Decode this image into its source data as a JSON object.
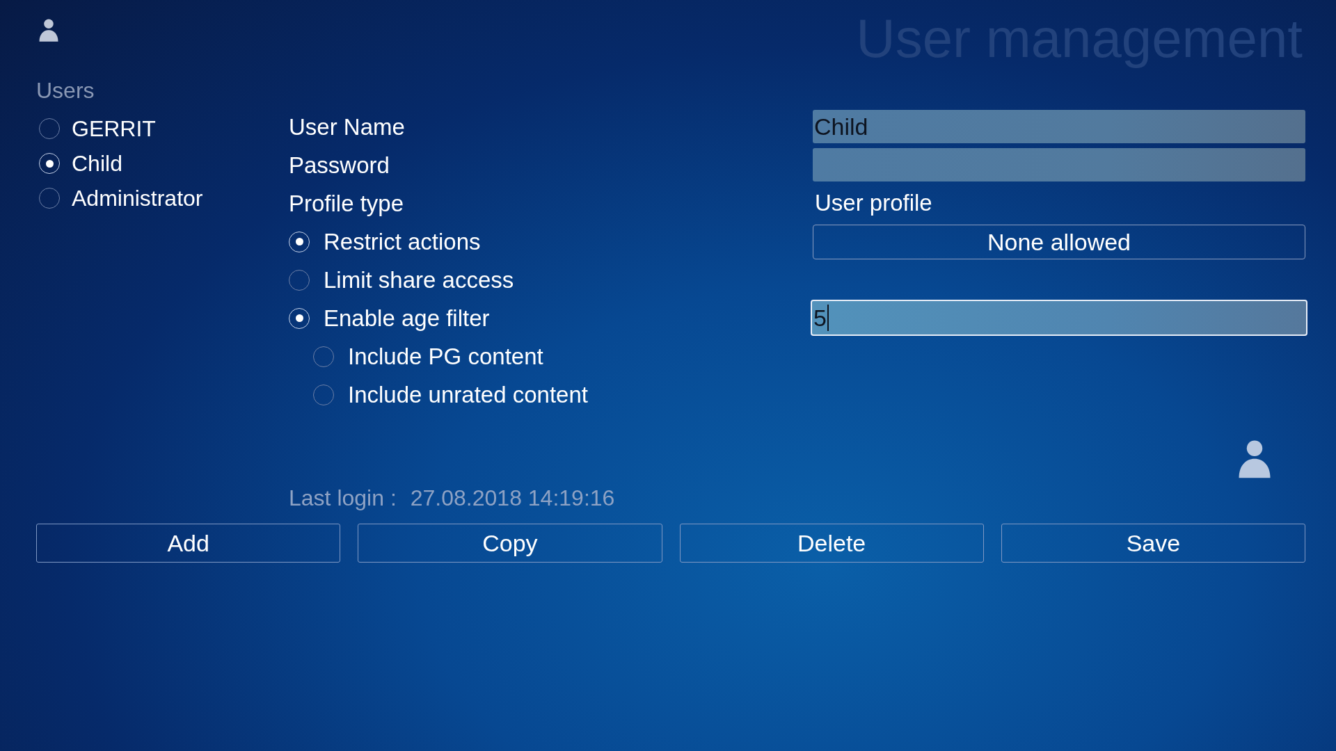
{
  "header": {
    "title": "User management"
  },
  "users": {
    "heading": "Users",
    "items": [
      {
        "name": "GERRIT",
        "selected": false
      },
      {
        "name": "Child",
        "selected": true
      },
      {
        "name": "Administrator",
        "selected": false
      }
    ]
  },
  "user_name": {
    "label": "User Name",
    "value": "Child"
  },
  "password": {
    "label": "Password"
  },
  "profile_type": {
    "label": "Profile type",
    "options": [
      {
        "label": "Restrict actions",
        "checked": true
      },
      {
        "label": "Limit share access",
        "checked": false
      },
      {
        "label": "Enable age filter",
        "checked": true,
        "children": [
          {
            "label": "Include PG content",
            "checked": false
          },
          {
            "label": "Include unrated content",
            "checked": false
          }
        ]
      }
    ]
  },
  "user_profile": {
    "label": "User profile",
    "value": "None allowed"
  },
  "age_filter": {
    "value": "5",
    "focused": true
  },
  "last_login": {
    "label": "Last login :",
    "value": "27.08.2018 14:19:16"
  },
  "buttons": [
    "Add",
    "Copy",
    "Delete",
    "Save"
  ]
}
